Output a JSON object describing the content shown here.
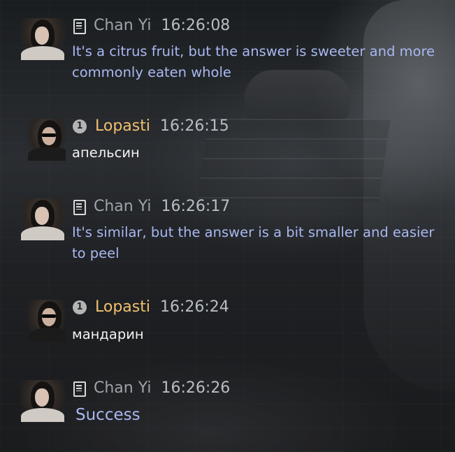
{
  "messages": [
    {
      "speaker": "Chan Yi",
      "time": "16:26:08",
      "text": "It's a citrus fruit, but the answer is sweeter and more commonly eaten whole",
      "icon": "scroll-icon"
    },
    {
      "speaker": "Lopasti",
      "time": "16:26:15",
      "text": "апельсин",
      "icon": "badge-icon",
      "badge": "1"
    },
    {
      "speaker": "Chan Yi",
      "time": "16:26:17",
      "text": "It's similar, but the answer is a bit smaller and easier to peel",
      "icon": "scroll-icon"
    },
    {
      "speaker": "Lopasti",
      "time": "16:26:24",
      "text": "мандарин",
      "icon": "badge-icon",
      "badge": "1"
    },
    {
      "speaker": "Chan Yi",
      "time": "16:26:26",
      "text": "Success",
      "icon": "scroll-icon"
    }
  ],
  "colors": {
    "npc_name": "#9ea3aa",
    "player_name": "#f0c070",
    "npc_text": "#a9b8f0",
    "player_text": "#f2f2f2",
    "timestamp": "#b8bdc4"
  }
}
